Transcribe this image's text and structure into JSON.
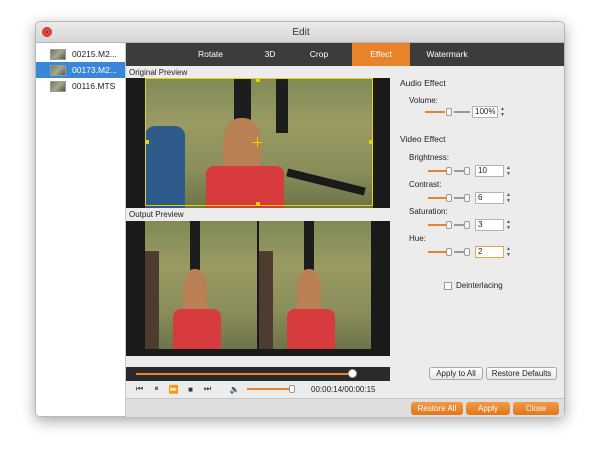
{
  "window": {
    "title": "Edit"
  },
  "files": [
    {
      "name": "00215.M2...",
      "selected": false
    },
    {
      "name": "00173.M2...",
      "selected": true
    },
    {
      "name": "00116.MTS",
      "selected": false
    }
  ],
  "tabs": [
    {
      "label": "Rotate",
      "active": false
    },
    {
      "label": "3D",
      "active": false
    },
    {
      "label": "Crop",
      "active": false
    },
    {
      "label": "Effect",
      "active": true
    },
    {
      "label": "Watermark",
      "active": false
    }
  ],
  "preview": {
    "original_label": "Original Preview",
    "output_label": "Output Preview"
  },
  "playback": {
    "timecode": "00:00:14/00:00:15",
    "progress": 0.93,
    "volume_level": 1.0
  },
  "audio_effect": {
    "heading": "Audio Effect",
    "volume_label": "Volume:",
    "volume_value": "100%",
    "volume_level": 0.55
  },
  "video_effect": {
    "heading": "Video Effect",
    "brightness_label": "Brightness:",
    "brightness_value": "10",
    "brightness_level": 0.55,
    "contrast_label": "Contrast:",
    "contrast_value": "6",
    "contrast_level": 0.55,
    "saturation_label": "Saturation:",
    "saturation_value": "3",
    "saturation_level": 0.55,
    "hue_label": "Hue:",
    "hue_value": "2",
    "hue_level": 0.55,
    "deinterlacing_label": "Deinterlacing",
    "deinterlacing_checked": false
  },
  "buttons": {
    "apply_to_all": "Apply to All",
    "restore_defaults": "Restore Defaults",
    "restore_all": "Restore All",
    "apply": "Apply",
    "close": "Close"
  },
  "colors": {
    "accent": "#e8832a",
    "selection": "#3a86d8",
    "tab_bar": "#3c3c3c"
  }
}
